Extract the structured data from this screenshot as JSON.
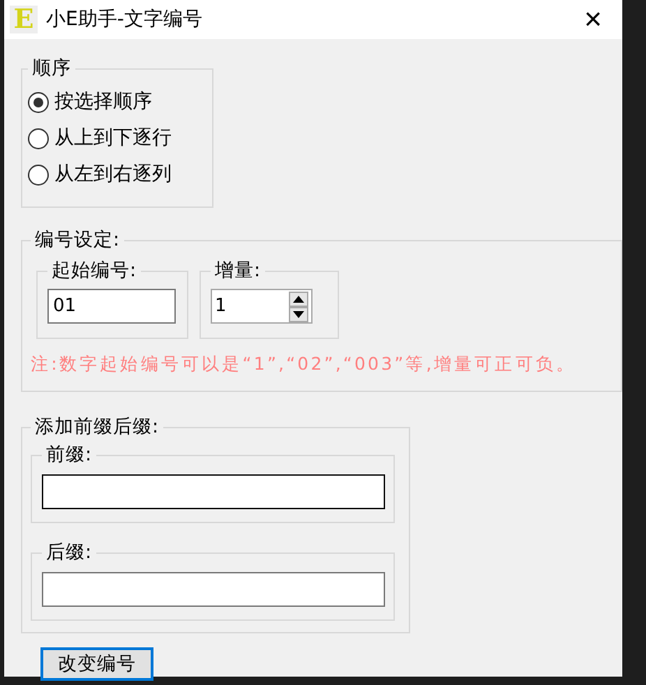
{
  "window": {
    "icon_letter": "E",
    "title": "小E助手-文字编号",
    "close": "×"
  },
  "order_group": {
    "title": "顺序",
    "options": [
      {
        "label": "按选择顺序",
        "selected": true
      },
      {
        "label": "从上到下逐行",
        "selected": false
      },
      {
        "label": "从左到右逐列",
        "selected": false
      }
    ]
  },
  "numbering_group": {
    "title": "编号设定:",
    "start": {
      "title": "起始编号:",
      "value": "01"
    },
    "increment": {
      "title": "增量:",
      "value": "1"
    },
    "note": "注:数字起始编号可以是“1”,“02”,“003”等,增量可正可负。"
  },
  "affix_group": {
    "title": "添加前缀后缀:",
    "prefix": {
      "title": "前缀:",
      "focused": true
    },
    "suffix": {
      "title": "后缀:",
      "focused": false
    }
  },
  "buttons": [
    {
      "label": "改变编号",
      "focused": true
    }
  ]
}
